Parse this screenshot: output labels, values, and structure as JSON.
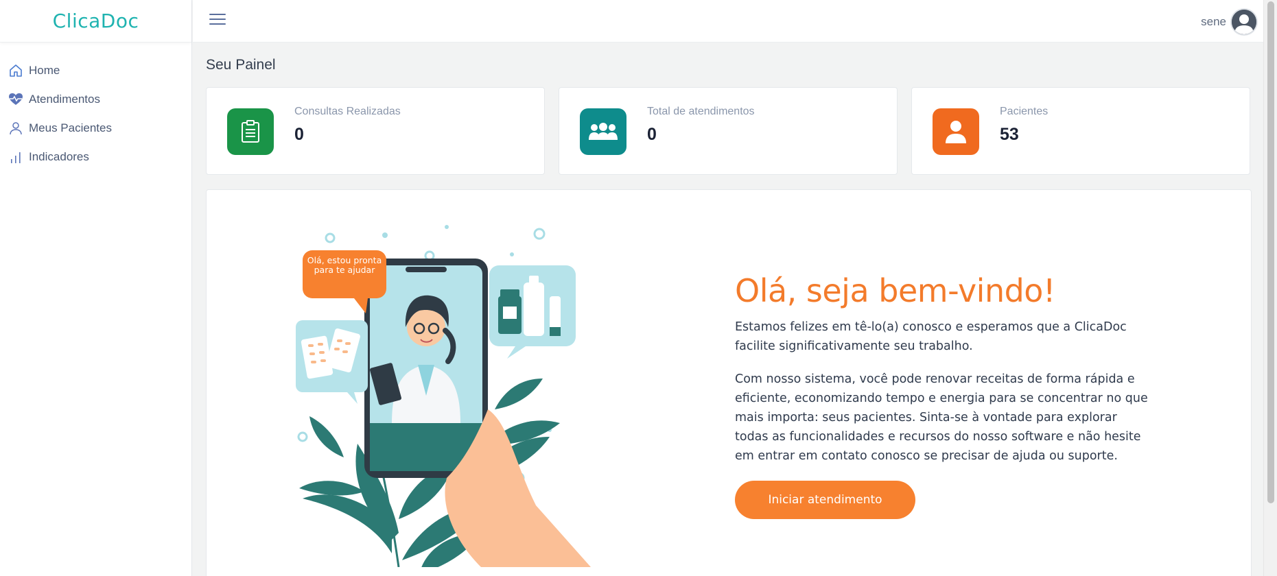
{
  "app": {
    "logo_text": "ClicaDoc"
  },
  "sidebar": {
    "items": [
      {
        "label": "Home",
        "icon": "home-icon"
      },
      {
        "label": "Atendimentos",
        "icon": "heartbeat-icon"
      },
      {
        "label": "Meus Pacientes",
        "icon": "user-icon"
      },
      {
        "label": "Indicadores",
        "icon": "bar-chart-icon"
      }
    ]
  },
  "topbar": {
    "menu_icon": "hamburger-icon",
    "username": "sene"
  },
  "page": {
    "title": "Seu Painel"
  },
  "stats": [
    {
      "label": "Consultas Realizadas",
      "value": "0",
      "icon": "clipboard-icon",
      "color": "#1a9448"
    },
    {
      "label": "Total de atendimentos",
      "value": "0",
      "icon": "group-icon",
      "color": "#0e8c8c"
    },
    {
      "label": "Pacientes",
      "value": "53",
      "icon": "person-icon",
      "color": "#f06a1f"
    }
  ],
  "welcome": {
    "title": "Olá, seja bem-vindo!",
    "paragraph1": "Estamos felizes em tê-lo(a) conosco e esperamos que a ClicaDoc facilite significativamente seu trabalho.",
    "paragraph2": "Com nosso sistema, você pode renovar receitas de forma rápida e eficiente, economizando tempo e energia para se concentrar no que mais importa: seus pacientes. Sinta-se à vontade para explorar todas as funcionalidades e recursos do nosso software e não hesite em entrar em contato conosco se precisar de ajuda ou suporte.",
    "button_label": "Iniciar atendimento",
    "illustration_bubble": "Olá, estou pronta para te ajudar",
    "accent_color": "#f37b2b"
  }
}
